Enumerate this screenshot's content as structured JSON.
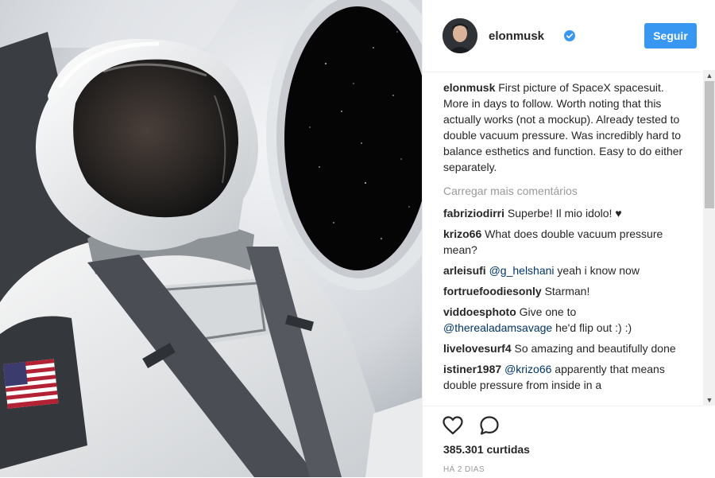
{
  "post": {
    "photo_description": "",
    "author": {
      "username": "elonmusk",
      "verified": true,
      "follow_label": "Seguir"
    },
    "caption": {
      "username": "elonmusk",
      "text": "First picture of SpaceX spacesuit. More in days to follow. Worth noting that this actually works (not a mockup). Already tested to double vacuum pressure. Was incredibly hard to balance esthetics and function. Easy to do either separately."
    },
    "load_more_label": "Carregar mais comentários",
    "comments": [
      {
        "username": "fabriziodirri",
        "text": "Superbe! Il mio idolo! ♥"
      },
      {
        "username": "krizo66",
        "text": "What does double vacuum pressure mean?"
      },
      {
        "username": "arleisufi",
        "mention": "@g_helshani",
        "text": "yeah i know now"
      },
      {
        "username": "fortruefoodiesonly",
        "text": "Starman!"
      },
      {
        "username": "viddoesphoto",
        "text": "Give one to",
        "mention": "@therealadamsavage",
        "text2": "he'd flip out :) :)"
      },
      {
        "username": "livelovesurf4",
        "text": "So amazing and beautifully done"
      },
      {
        "username": "istiner1987",
        "mention": "@krizo66",
        "text": "apparently that means double pressure from inside in a"
      }
    ],
    "likes_text": "385.301 curtidas",
    "time_ago": "HÁ 2 DIAS"
  },
  "icons": {
    "like": "heart-outline-icon",
    "comment": "speech-bubble-icon",
    "verified": "verified-badge-icon"
  },
  "colors": {
    "follow_button": "#3897f0",
    "mention": "#003569",
    "muted": "#999999",
    "verified": "#3897f0"
  }
}
